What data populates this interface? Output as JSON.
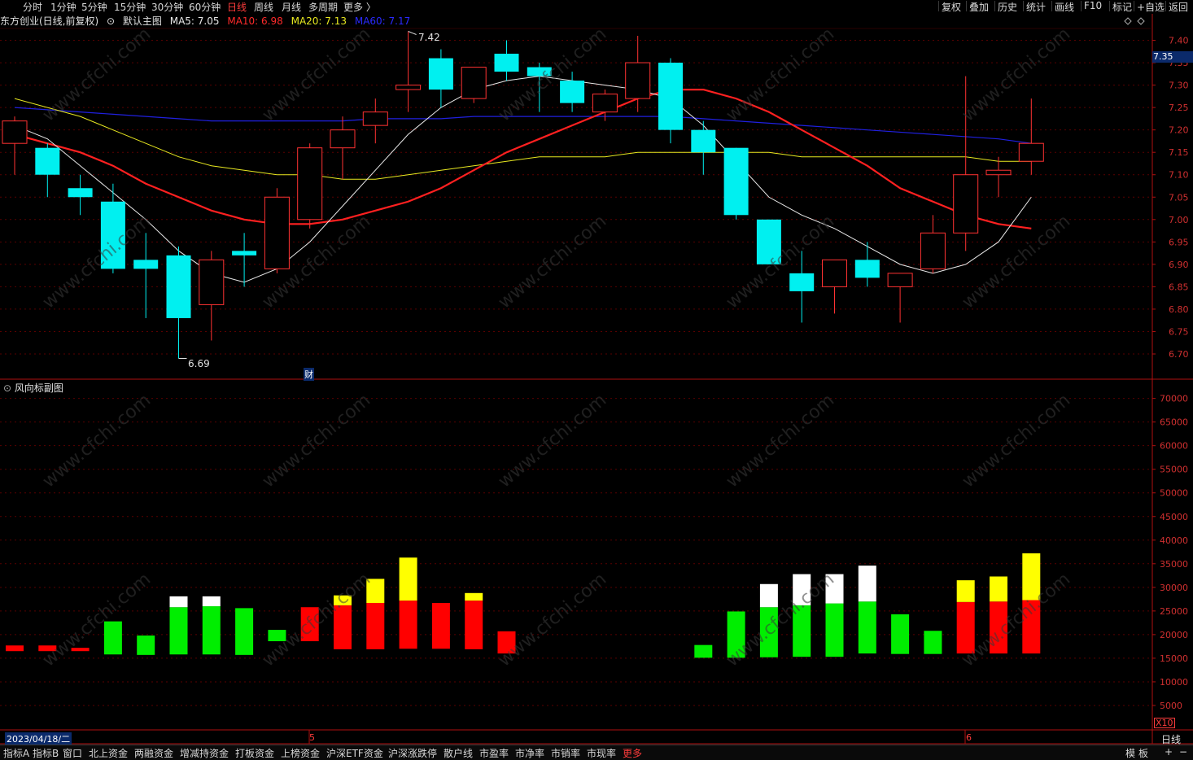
{
  "toolbar": {
    "periods": [
      "分时",
      "1分钟",
      "5分钟",
      "15分钟",
      "30分钟",
      "60分钟",
      "日线",
      "周线",
      "月线",
      "多周期",
      "更多 〉"
    ],
    "active_period": "日线",
    "tools": [
      "复权",
      "叠加",
      "历史",
      "统计",
      "画线",
      "F10",
      "标记",
      "+自选",
      "返回"
    ]
  },
  "info": {
    "stock": "东方创业(日线,前复权)",
    "main_chart_label": "默认主图",
    "ma5": "MA5: 7.05",
    "ma10": "MA10: 6.98",
    "ma20": "MA20: 7.13",
    "ma60": "MA60: 7.17"
  },
  "sub_chart": {
    "title": "风向标副图",
    "scale_label": "X10"
  },
  "colors": {
    "ma5": "#e8e8e8",
    "ma10": "#ff2020",
    "ma20": "#e8e820",
    "ma60": "#2020e0",
    "up": "#ff3232",
    "down": "#00f0f0",
    "vol_red": "#ff0000",
    "vol_green": "#00ee00",
    "vol_yellow": "#ffff00",
    "vol_white": "#ffffff"
  },
  "annotations": {
    "high": "7.42",
    "low": "6.69",
    "event_marker": "财",
    "current_price": "7.35"
  },
  "x_axis": {
    "start_date": "2023/04/18/二",
    "month_labels": [
      "5",
      "6"
    ],
    "period_label": "日线"
  },
  "bottom_tabs": [
    "指标A",
    "指标B",
    "窗口",
    "北上资金",
    "两融资金",
    "增减持资金",
    "打板资金",
    "上榜资金",
    "沪深ETF资金",
    "沪深涨跌停",
    "散户线",
    "市盈率",
    "市净率",
    "市销率",
    "市现率",
    "更多"
  ],
  "bottom_right": [
    "模",
    "板",
    "+",
    "−"
  ],
  "watermark": "www.cfchi.com",
  "chart_data": [
    {
      "type": "candlestick",
      "title": "东方创业(日线,前复权)",
      "y_ticks": [
        "7.40",
        "7.35",
        "7.30",
        "7.25",
        "7.20",
        "7.15",
        "7.10",
        "7.05",
        "7.00",
        "6.95",
        "6.90",
        "6.85",
        "6.80",
        "6.75",
        "6.70"
      ],
      "ylim": [
        6.68,
        7.45
      ],
      "candles": [
        {
          "o": 7.17,
          "h": 7.23,
          "l": 7.1,
          "c": 7.22
        },
        {
          "o": 7.16,
          "h": 7.17,
          "l": 7.05,
          "c": 7.1
        },
        {
          "o": 7.07,
          "h": 7.1,
          "l": 7.01,
          "c": 7.05
        },
        {
          "o": 7.04,
          "h": 7.08,
          "l": 6.88,
          "c": 6.89
        },
        {
          "o": 6.91,
          "h": 6.97,
          "l": 6.78,
          "c": 6.89
        },
        {
          "o": 6.92,
          "h": 6.94,
          "l": 6.69,
          "c": 6.78
        },
        {
          "o": 6.81,
          "h": 6.93,
          "l": 6.73,
          "c": 6.91
        },
        {
          "o": 6.93,
          "h": 6.97,
          "l": 6.85,
          "c": 6.92
        },
        {
          "o": 6.89,
          "h": 7.07,
          "l": 6.88,
          "c": 7.05
        },
        {
          "o": 7.0,
          "h": 7.17,
          "l": 6.98,
          "c": 7.16
        },
        {
          "o": 7.16,
          "h": 7.23,
          "l": 7.09,
          "c": 7.2
        },
        {
          "o": 7.21,
          "h": 7.27,
          "l": 7.17,
          "c": 7.24
        },
        {
          "o": 7.29,
          "h": 7.42,
          "l": 7.24,
          "c": 7.3
        },
        {
          "o": 7.36,
          "h": 7.38,
          "l": 7.25,
          "c": 7.29
        },
        {
          "o": 7.27,
          "h": 7.34,
          "l": 7.26,
          "c": 7.34
        },
        {
          "o": 7.37,
          "h": 7.4,
          "l": 7.31,
          "c": 7.33
        },
        {
          "o": 7.34,
          "h": 7.35,
          "l": 7.24,
          "c": 7.32
        },
        {
          "o": 7.31,
          "h": 7.33,
          "l": 7.24,
          "c": 7.26
        },
        {
          "o": 7.24,
          "h": 7.29,
          "l": 7.22,
          "c": 7.28
        },
        {
          "o": 7.27,
          "h": 7.41,
          "l": 7.24,
          "c": 7.35
        },
        {
          "o": 7.35,
          "h": 7.36,
          "l": 7.17,
          "c": 7.2
        },
        {
          "o": 7.2,
          "h": 7.22,
          "l": 7.1,
          "c": 7.15
        },
        {
          "o": 7.16,
          "h": 7.16,
          "l": 7.0,
          "c": 7.01
        },
        {
          "o": 7.0,
          "h": 7.0,
          "l": 6.9,
          "c": 6.9
        },
        {
          "o": 6.88,
          "h": 6.93,
          "l": 6.77,
          "c": 6.84
        },
        {
          "o": 6.85,
          "h": 6.91,
          "l": 6.79,
          "c": 6.91
        },
        {
          "o": 6.91,
          "h": 6.95,
          "l": 6.85,
          "c": 6.87
        },
        {
          "o": 6.85,
          "h": 6.88,
          "l": 6.77,
          "c": 6.88
        },
        {
          "o": 6.89,
          "h": 7.01,
          "l": 6.88,
          "c": 6.97
        },
        {
          "o": 6.97,
          "h": 7.32,
          "l": 6.93,
          "c": 7.1
        },
        {
          "o": 7.1,
          "h": 7.14,
          "l": 7.05,
          "c": 7.11
        },
        {
          "o": 7.13,
          "h": 7.27,
          "l": 7.1,
          "c": 7.17
        }
      ],
      "ma5": [
        7.21,
        7.18,
        7.12,
        7.06,
        7.0,
        6.93,
        6.88,
        6.86,
        6.89,
        6.95,
        7.03,
        7.11,
        7.19,
        7.25,
        7.29,
        7.31,
        7.32,
        7.31,
        7.3,
        7.29,
        7.27,
        7.21,
        7.13,
        7.05,
        7.01,
        6.98,
        6.94,
        6.9,
        6.88,
        6.9,
        6.95,
        7.05
      ],
      "ma10": [
        7.19,
        7.17,
        7.15,
        7.12,
        7.08,
        7.05,
        7.02,
        7.0,
        6.99,
        6.99,
        7.0,
        7.02,
        7.04,
        7.07,
        7.11,
        7.15,
        7.18,
        7.21,
        7.24,
        7.27,
        7.29,
        7.29,
        7.27,
        7.24,
        7.2,
        7.16,
        7.12,
        7.07,
        7.04,
        7.01,
        6.99,
        6.98
      ],
      "ma20": [
        7.27,
        7.25,
        7.23,
        7.2,
        7.17,
        7.14,
        7.12,
        7.11,
        7.1,
        7.1,
        7.09,
        7.09,
        7.1,
        7.11,
        7.12,
        7.13,
        7.14,
        7.14,
        7.14,
        7.15,
        7.15,
        7.15,
        7.15,
        7.15,
        7.14,
        7.14,
        7.14,
        7.14,
        7.14,
        7.14,
        7.13,
        7.13
      ],
      "ma60": [
        7.25,
        7.245,
        7.24,
        7.235,
        7.23,
        7.225,
        7.22,
        7.22,
        7.22,
        7.22,
        7.22,
        7.225,
        7.225,
        7.225,
        7.23,
        7.23,
        7.23,
        7.23,
        7.23,
        7.23,
        7.23,
        7.225,
        7.22,
        7.215,
        7.21,
        7.205,
        7.2,
        7.195,
        7.19,
        7.185,
        7.18,
        7.17
      ]
    },
    {
      "type": "bar",
      "title": "风向标副图",
      "y_ticks": [
        "70000",
        "65000",
        "60000",
        "55000",
        "50000",
        "45000",
        "40000",
        "35000",
        "30000",
        "25000",
        "20000",
        "15000",
        "10000",
        "5000"
      ],
      "ylim": [
        0,
        72000
      ],
      "bars": [
        {
          "base": 16500,
          "top": 17700,
          "color": "red",
          "cap": null
        },
        {
          "base": 16500,
          "top": 17700,
          "color": "red",
          "cap": null
        },
        {
          "base": 16500,
          "top": 17200,
          "color": "red",
          "cap": null
        },
        {
          "base": 15800,
          "top": 22800,
          "color": "green",
          "cap": null
        },
        {
          "base": 15700,
          "top": 19800,
          "color": "green",
          "cap": null
        },
        {
          "base": 15800,
          "top": 25800,
          "color": "green",
          "cap": {
            "color": "white",
            "top": 28100
          }
        },
        {
          "base": 15800,
          "top": 26000,
          "color": "green",
          "cap": {
            "color": "white",
            "top": 28100
          }
        },
        {
          "base": 15700,
          "top": 25600,
          "color": "green",
          "cap": null
        },
        {
          "base": 18600,
          "top": 21000,
          "color": "green",
          "cap": null
        },
        {
          "base": 18600,
          "top": 25800,
          "color": "red",
          "cap": null
        },
        {
          "base": 16900,
          "top": 26200,
          "color": "red",
          "cap": {
            "color": "yellow",
            "top": 28300
          }
        },
        {
          "base": 16900,
          "top": 26700,
          "color": "red",
          "cap": {
            "color": "yellow",
            "top": 31800
          }
        },
        {
          "base": 17000,
          "top": 27200,
          "color": "red",
          "cap": {
            "color": "yellow",
            "top": 36300
          }
        },
        {
          "base": 17000,
          "top": 26700,
          "color": "red",
          "cap": null
        },
        {
          "base": 16900,
          "top": 27200,
          "color": "red",
          "cap": {
            "color": "yellow",
            "top": 28800
          }
        },
        {
          "base": 16000,
          "top": 20700,
          "color": "red",
          "cap": null
        },
        null,
        null,
        null,
        null,
        null,
        {
          "base": 15100,
          "top": 17800,
          "color": "green",
          "cap": null
        },
        {
          "base": 15100,
          "top": 24900,
          "color": "green",
          "cap": null
        },
        {
          "base": 15200,
          "top": 25800,
          "color": "green",
          "cap": {
            "color": "white",
            "top": 30700
          }
        },
        {
          "base": 15300,
          "top": 26200,
          "color": "green",
          "cap": {
            "color": "white",
            "top": 32800
          }
        },
        {
          "base": 15300,
          "top": 26600,
          "color": "green",
          "cap": {
            "color": "white",
            "top": 32800
          }
        },
        {
          "base": 16000,
          "top": 27000,
          "color": "green",
          "cap": {
            "color": "white",
            "top": 34600
          }
        },
        {
          "base": 15900,
          "top": 24300,
          "color": "green",
          "cap": null
        },
        {
          "base": 15900,
          "top": 20800,
          "color": "green",
          "cap": null
        },
        {
          "base": 16000,
          "top": 26900,
          "color": "red",
          "cap": {
            "color": "yellow",
            "top": 31500
          }
        },
        {
          "base": 16000,
          "top": 27000,
          "color": "red",
          "cap": {
            "color": "yellow",
            "top": 32300
          }
        },
        {
          "base": 16000,
          "top": 27300,
          "color": "red",
          "cap": {
            "color": "yellow",
            "top": 37200
          }
        }
      ]
    }
  ]
}
